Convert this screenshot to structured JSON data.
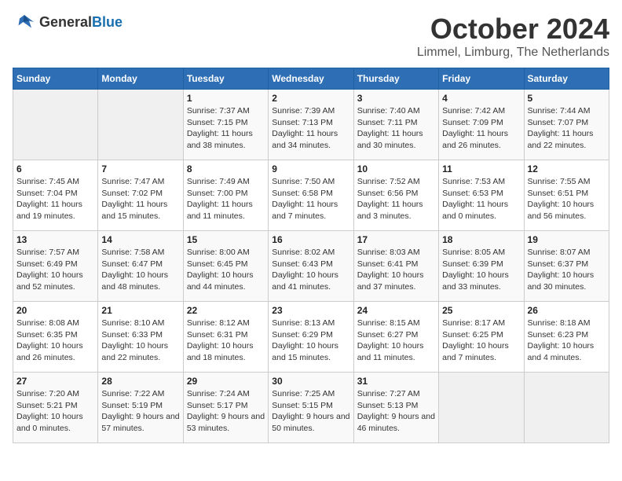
{
  "header": {
    "logo_general": "General",
    "logo_blue": "Blue",
    "month_title": "October 2024",
    "location": "Limmel, Limburg, The Netherlands"
  },
  "days_of_week": [
    "Sunday",
    "Monday",
    "Tuesday",
    "Wednesday",
    "Thursday",
    "Friday",
    "Saturday"
  ],
  "weeks": [
    [
      {
        "day": "",
        "sunrise": "",
        "sunset": "",
        "daylight": ""
      },
      {
        "day": "",
        "sunrise": "",
        "sunset": "",
        "daylight": ""
      },
      {
        "day": "1",
        "sunrise": "Sunrise: 7:37 AM",
        "sunset": "Sunset: 7:15 PM",
        "daylight": "Daylight: 11 hours and 38 minutes."
      },
      {
        "day": "2",
        "sunrise": "Sunrise: 7:39 AM",
        "sunset": "Sunset: 7:13 PM",
        "daylight": "Daylight: 11 hours and 34 minutes."
      },
      {
        "day": "3",
        "sunrise": "Sunrise: 7:40 AM",
        "sunset": "Sunset: 7:11 PM",
        "daylight": "Daylight: 11 hours and 30 minutes."
      },
      {
        "day": "4",
        "sunrise": "Sunrise: 7:42 AM",
        "sunset": "Sunset: 7:09 PM",
        "daylight": "Daylight: 11 hours and 26 minutes."
      },
      {
        "day": "5",
        "sunrise": "Sunrise: 7:44 AM",
        "sunset": "Sunset: 7:07 PM",
        "daylight": "Daylight: 11 hours and 22 minutes."
      }
    ],
    [
      {
        "day": "6",
        "sunrise": "Sunrise: 7:45 AM",
        "sunset": "Sunset: 7:04 PM",
        "daylight": "Daylight: 11 hours and 19 minutes."
      },
      {
        "day": "7",
        "sunrise": "Sunrise: 7:47 AM",
        "sunset": "Sunset: 7:02 PM",
        "daylight": "Daylight: 11 hours and 15 minutes."
      },
      {
        "day": "8",
        "sunrise": "Sunrise: 7:49 AM",
        "sunset": "Sunset: 7:00 PM",
        "daylight": "Daylight: 11 hours and 11 minutes."
      },
      {
        "day": "9",
        "sunrise": "Sunrise: 7:50 AM",
        "sunset": "Sunset: 6:58 PM",
        "daylight": "Daylight: 11 hours and 7 minutes."
      },
      {
        "day": "10",
        "sunrise": "Sunrise: 7:52 AM",
        "sunset": "Sunset: 6:56 PM",
        "daylight": "Daylight: 11 hours and 3 minutes."
      },
      {
        "day": "11",
        "sunrise": "Sunrise: 7:53 AM",
        "sunset": "Sunset: 6:53 PM",
        "daylight": "Daylight: 11 hours and 0 minutes."
      },
      {
        "day": "12",
        "sunrise": "Sunrise: 7:55 AM",
        "sunset": "Sunset: 6:51 PM",
        "daylight": "Daylight: 10 hours and 56 minutes."
      }
    ],
    [
      {
        "day": "13",
        "sunrise": "Sunrise: 7:57 AM",
        "sunset": "Sunset: 6:49 PM",
        "daylight": "Daylight: 10 hours and 52 minutes."
      },
      {
        "day": "14",
        "sunrise": "Sunrise: 7:58 AM",
        "sunset": "Sunset: 6:47 PM",
        "daylight": "Daylight: 10 hours and 48 minutes."
      },
      {
        "day": "15",
        "sunrise": "Sunrise: 8:00 AM",
        "sunset": "Sunset: 6:45 PM",
        "daylight": "Daylight: 10 hours and 44 minutes."
      },
      {
        "day": "16",
        "sunrise": "Sunrise: 8:02 AM",
        "sunset": "Sunset: 6:43 PM",
        "daylight": "Daylight: 10 hours and 41 minutes."
      },
      {
        "day": "17",
        "sunrise": "Sunrise: 8:03 AM",
        "sunset": "Sunset: 6:41 PM",
        "daylight": "Daylight: 10 hours and 37 minutes."
      },
      {
        "day": "18",
        "sunrise": "Sunrise: 8:05 AM",
        "sunset": "Sunset: 6:39 PM",
        "daylight": "Daylight: 10 hours and 33 minutes."
      },
      {
        "day": "19",
        "sunrise": "Sunrise: 8:07 AM",
        "sunset": "Sunset: 6:37 PM",
        "daylight": "Daylight: 10 hours and 30 minutes."
      }
    ],
    [
      {
        "day": "20",
        "sunrise": "Sunrise: 8:08 AM",
        "sunset": "Sunset: 6:35 PM",
        "daylight": "Daylight: 10 hours and 26 minutes."
      },
      {
        "day": "21",
        "sunrise": "Sunrise: 8:10 AM",
        "sunset": "Sunset: 6:33 PM",
        "daylight": "Daylight: 10 hours and 22 minutes."
      },
      {
        "day": "22",
        "sunrise": "Sunrise: 8:12 AM",
        "sunset": "Sunset: 6:31 PM",
        "daylight": "Daylight: 10 hours and 18 minutes."
      },
      {
        "day": "23",
        "sunrise": "Sunrise: 8:13 AM",
        "sunset": "Sunset: 6:29 PM",
        "daylight": "Daylight: 10 hours and 15 minutes."
      },
      {
        "day": "24",
        "sunrise": "Sunrise: 8:15 AM",
        "sunset": "Sunset: 6:27 PM",
        "daylight": "Daylight: 10 hours and 11 minutes."
      },
      {
        "day": "25",
        "sunrise": "Sunrise: 8:17 AM",
        "sunset": "Sunset: 6:25 PM",
        "daylight": "Daylight: 10 hours and 7 minutes."
      },
      {
        "day": "26",
        "sunrise": "Sunrise: 8:18 AM",
        "sunset": "Sunset: 6:23 PM",
        "daylight": "Daylight: 10 hours and 4 minutes."
      }
    ],
    [
      {
        "day": "27",
        "sunrise": "Sunrise: 7:20 AM",
        "sunset": "Sunset: 5:21 PM",
        "daylight": "Daylight: 10 hours and 0 minutes."
      },
      {
        "day": "28",
        "sunrise": "Sunrise: 7:22 AM",
        "sunset": "Sunset: 5:19 PM",
        "daylight": "Daylight: 9 hours and 57 minutes."
      },
      {
        "day": "29",
        "sunrise": "Sunrise: 7:24 AM",
        "sunset": "Sunset: 5:17 PM",
        "daylight": "Daylight: 9 hours and 53 minutes."
      },
      {
        "day": "30",
        "sunrise": "Sunrise: 7:25 AM",
        "sunset": "Sunset: 5:15 PM",
        "daylight": "Daylight: 9 hours and 50 minutes."
      },
      {
        "day": "31",
        "sunrise": "Sunrise: 7:27 AM",
        "sunset": "Sunset: 5:13 PM",
        "daylight": "Daylight: 9 hours and 46 minutes."
      },
      {
        "day": "",
        "sunrise": "",
        "sunset": "",
        "daylight": ""
      },
      {
        "day": "",
        "sunrise": "",
        "sunset": "",
        "daylight": ""
      }
    ]
  ]
}
